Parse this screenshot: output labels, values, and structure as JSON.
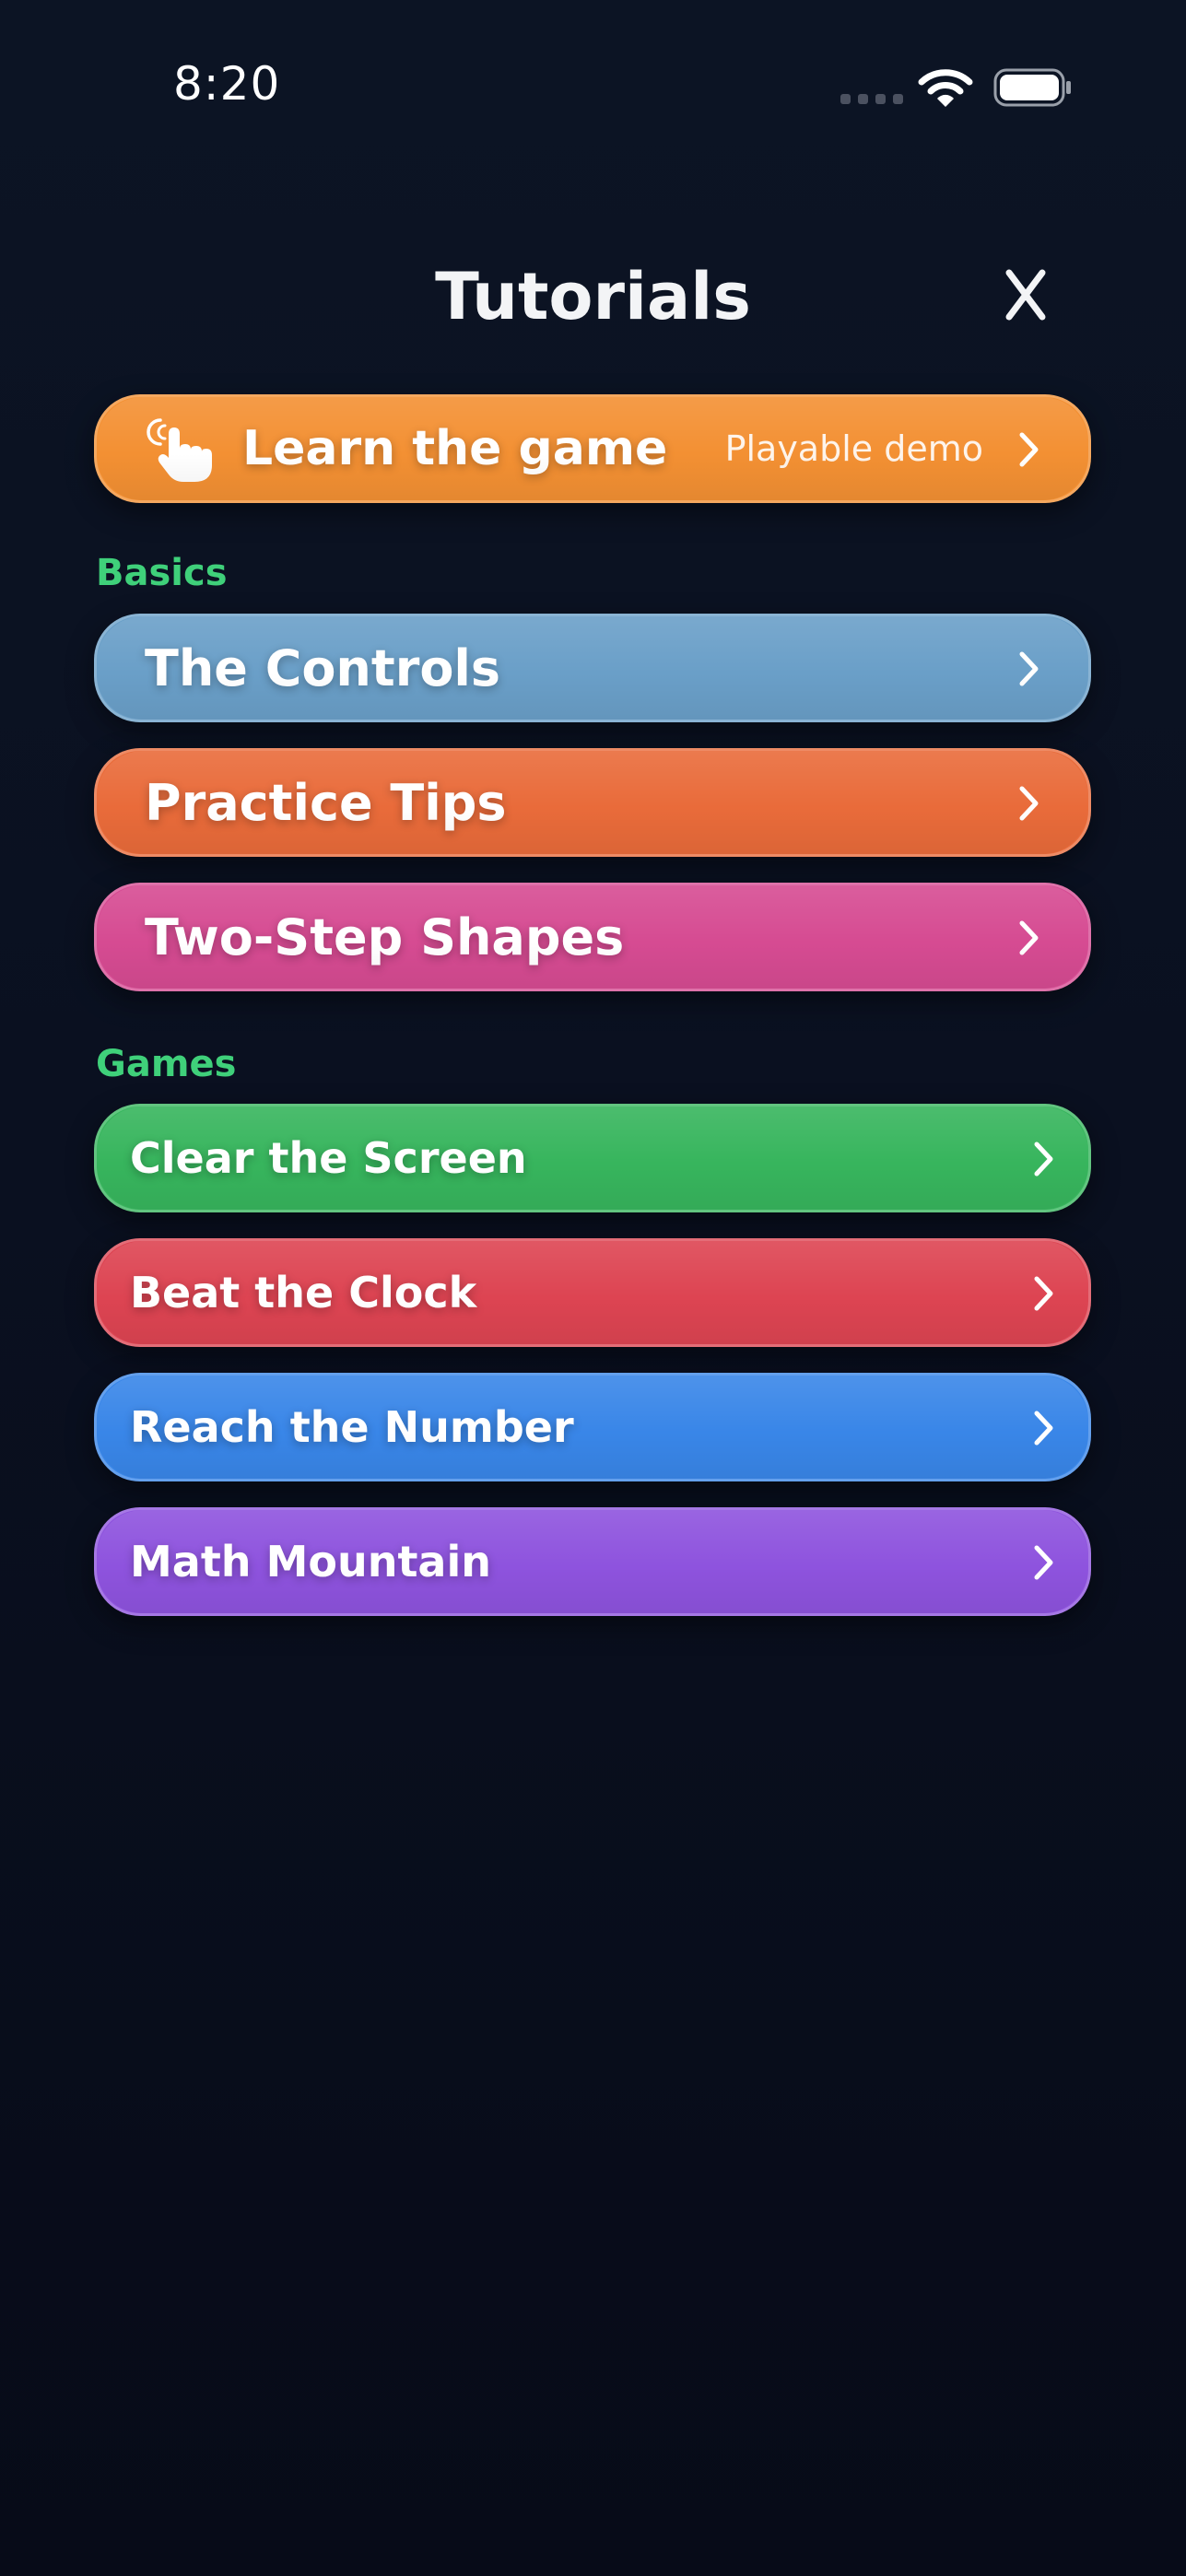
{
  "status_bar": {
    "time": "8:20",
    "icons": [
      "cellular-signal-icon",
      "wifi-icon",
      "battery-icon"
    ]
  },
  "header": {
    "title": "Tutorials",
    "close_icon": "close-icon"
  },
  "demo": {
    "label": "Learn the game",
    "tag": "Playable demo",
    "icon": "pointing-hand-icon",
    "color": "#F39033"
  },
  "basics": {
    "heading": "Basics",
    "items": [
      {
        "label": "The Controls",
        "color": "#6A9FC8"
      },
      {
        "label": "Practice Tips",
        "color": "#E96B3A"
      },
      {
        "label": "Two-Step Shapes",
        "color": "#D64B92"
      }
    ]
  },
  "games": {
    "heading": "Games",
    "items": [
      {
        "label": "Clear the Screen",
        "color": "#37B55D"
      },
      {
        "label": "Beat the Clock",
        "color": "#DD4452"
      },
      {
        "label": "Reach the Number",
        "color": "#3986E8"
      },
      {
        "label": "Math Mountain",
        "color": "#8E53DE"
      }
    ]
  },
  "theme": {
    "section_heading_color": "#3FD07A",
    "background_top": "#0C1424",
    "background_bottom": "#070B18"
  }
}
